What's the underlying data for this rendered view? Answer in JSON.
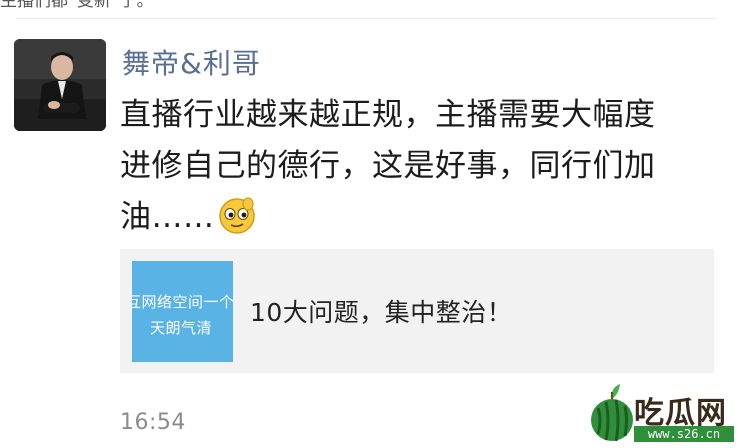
{
  "previous_post": {
    "text": "主播们都“变新”了。"
  },
  "post": {
    "author_name": "舞帝&利哥",
    "text_lines": [
      "直播行业越来越正规，主播需要大幅度",
      "进修自己的德行，这是好事，同行们加",
      "油……"
    ],
    "emoji": "smirk-emoji-icon",
    "link_card": {
      "thumb_line1": "互网络空间一个",
      "thumb_line2": "天朗气清",
      "title": "10大问题，集中整治！",
      "thumb_color": "#5ab3e5"
    },
    "timestamp": "16:54"
  },
  "watermark": {
    "brand": "吃瓜网",
    "url": "www.s26.cn"
  },
  "colors": {
    "author_name": "#5a6e95",
    "card_background": "#f2f2f2",
    "timestamp": "#8c8c8c"
  }
}
